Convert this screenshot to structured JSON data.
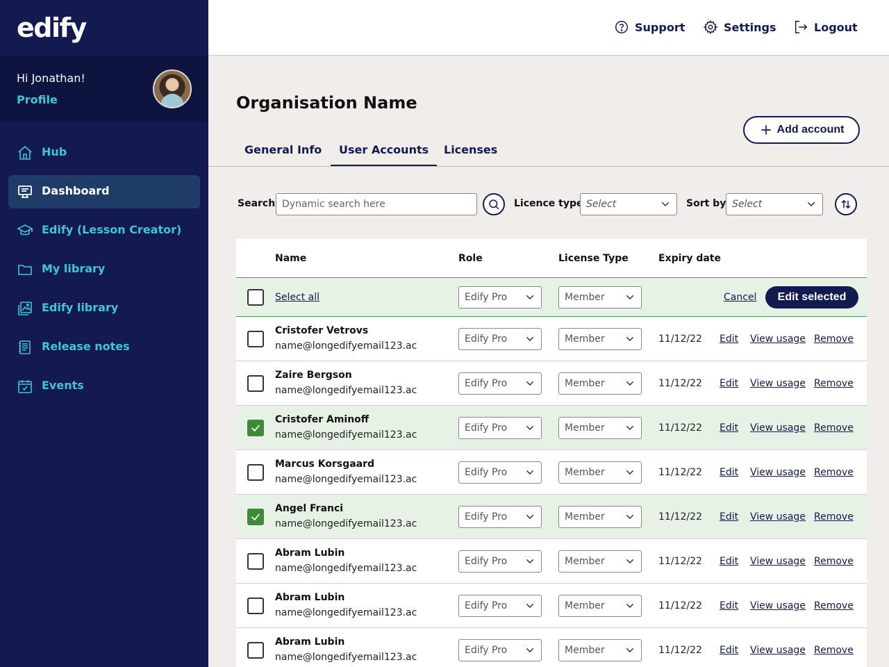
{
  "brand": {
    "logo": "edify"
  },
  "sidebar": {
    "greeting": "Hi Jonathan!",
    "profile_link": "Profile",
    "items": [
      {
        "label": "Hub",
        "icon": "home-icon"
      },
      {
        "label": "Dashboard",
        "icon": "dashboard-icon",
        "active": true
      },
      {
        "label": "Edify (Lesson Creator)",
        "icon": "graduation-cap-icon"
      },
      {
        "label": "My library",
        "icon": "folder-icon"
      },
      {
        "label": "Edify library",
        "icon": "image-library-icon"
      },
      {
        "label": "Release notes",
        "icon": "notes-icon"
      },
      {
        "label": "Events",
        "icon": "calendar-icon"
      }
    ]
  },
  "header": {
    "support": "Support",
    "settings": "Settings",
    "logout": "Logout"
  },
  "main": {
    "title": "Organisation Name",
    "add_account": "Add account",
    "tabs": [
      {
        "label": "General Info"
      },
      {
        "label": "User Accounts",
        "active": true
      },
      {
        "label": "Licenses"
      }
    ],
    "filters": {
      "search_label": "Search",
      "search_placeholder": "Dynamic search here",
      "licence_label": "Licence type",
      "licence_value": "Select",
      "sort_label": "Sort by",
      "sort_value": "Select"
    }
  },
  "table": {
    "headers": {
      "name": "Name",
      "role": "Role",
      "license": "License Type",
      "expiry": "Expiry date"
    },
    "bulk": {
      "select_all": "Select all",
      "role": "Edify Pro",
      "license": "Member",
      "cancel": "Cancel",
      "edit_selected": "Edit selected"
    },
    "actions": {
      "edit": "Edit",
      "view_usage": "View usage",
      "remove": "Remove"
    },
    "rows": [
      {
        "name": "Cristofer Vetrovs",
        "email": "name@longedifyemail123.ac",
        "role": "Edify Pro",
        "license": "Member",
        "expiry": "11/12/22",
        "checked": false
      },
      {
        "name": "Zaire Bergson",
        "email": "name@longedifyemail123.ac",
        "role": "Edify Pro",
        "license": "Member",
        "expiry": "11/12/22",
        "checked": false
      },
      {
        "name": "Cristofer Aminoff",
        "email": "name@longedifyemail123.ac",
        "role": "Edify Pro",
        "license": "Member",
        "expiry": "11/12/22",
        "checked": true
      },
      {
        "name": "Marcus Korsgaard",
        "email": "name@longedifyemail123.ac",
        "role": "Edify Pro",
        "license": "Member",
        "expiry": "11/12/22",
        "checked": false
      },
      {
        "name": "Angel Franci",
        "email": "name@longedifyemail123.ac",
        "role": "Edify Pro",
        "license": "Member",
        "expiry": "11/12/22",
        "checked": true
      },
      {
        "name": "Abram Lubin",
        "email": "name@longedifyemail123.ac",
        "role": "Edify Pro",
        "license": "Member",
        "expiry": "11/12/22",
        "checked": false
      },
      {
        "name": "Abram Lubin",
        "email": "name@longedifyemail123.ac",
        "role": "Edify Pro",
        "license": "Member",
        "expiry": "11/12/22",
        "checked": false
      },
      {
        "name": "Abram Lubin",
        "email": "name@longedifyemail123.ac",
        "role": "Edify Pro",
        "license": "Member",
        "expiry": "11/12/22",
        "checked": false
      }
    ]
  },
  "colors": {
    "navy": "#131a4f",
    "teal": "#3ec6d4",
    "selected_row": "#e7f1e5",
    "check_green": "#3f8a3a"
  }
}
